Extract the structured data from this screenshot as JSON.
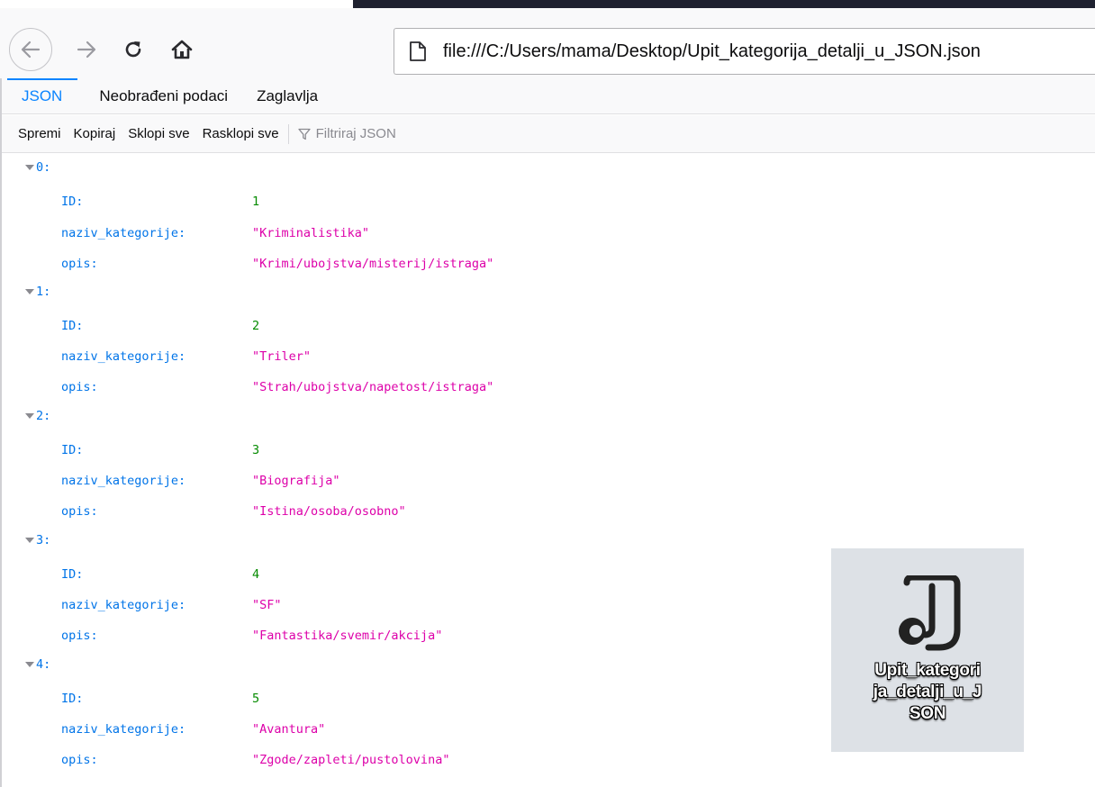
{
  "browser": {
    "url": "file:///C:/Users/mama/Desktop/Upit_kategorija_detalji_u_JSON.json",
    "icons": {
      "back": "arrow-left-icon",
      "forward": "arrow-right-icon",
      "reload": "reload-icon",
      "home": "home-icon",
      "page": "page-icon"
    }
  },
  "viewer": {
    "tabs": [
      {
        "label": "JSON",
        "active": true
      },
      {
        "label": "Neobrađeni podaci",
        "active": false
      },
      {
        "label": "Zaglavlja",
        "active": false
      }
    ],
    "toolbar": {
      "save": "Spremi",
      "copy": "Kopiraj",
      "collapse_all": "Sklopi sve",
      "expand_all": "Rasklopi sve",
      "filter_placeholder": "Filtriraj JSON"
    }
  },
  "records": [
    {
      "index": "0:",
      "id_key": "ID:",
      "id": "1",
      "name_key": "naziv_kategorije:",
      "name": "\"Kriminalistika\"",
      "desc_key": "opis:",
      "desc": "\"Krimi/ubojstva/misterij/istraga\""
    },
    {
      "index": "1:",
      "id_key": "ID:",
      "id": "2",
      "name_key": "naziv_kategorije:",
      "name": "\"Triler\"",
      "desc_key": "opis:",
      "desc": "\"Strah/ubojstva/napetost/istraga\""
    },
    {
      "index": "2:",
      "id_key": "ID:",
      "id": "3",
      "name_key": "naziv_kategorije:",
      "name": "\"Biografija\"",
      "desc_key": "opis:",
      "desc": "\"Istina/osoba/osobno\""
    },
    {
      "index": "3:",
      "id_key": "ID:",
      "id": "4",
      "name_key": "naziv_kategorije:",
      "name": "\"SF\"",
      "desc_key": "opis:",
      "desc": "\"Fantastika/svemir/akcija\""
    },
    {
      "index": "4:",
      "id_key": "ID:",
      "id": "5",
      "name_key": "naziv_kategorije:",
      "name": "\"Avantura\"",
      "desc_key": "opis:",
      "desc": "\"Zgode/zapleti/pustolovina\""
    }
  ],
  "desktop_file": {
    "label_line1": "Upit_kategori",
    "label_line2": "ja_detalji_u_J",
    "label_line3": "SON",
    "icon": "json-file-icon"
  },
  "colors": {
    "key": "#0074e8",
    "number": "#058b00",
    "string": "#dd00a9",
    "accent": "#0a84ff"
  }
}
